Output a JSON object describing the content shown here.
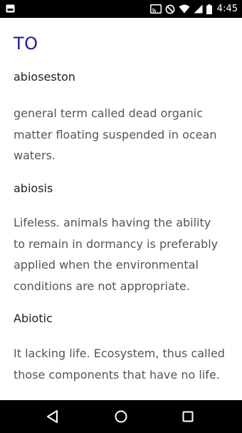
{
  "status_bar": {
    "time": "4:45",
    "left_icon": "notification-icon",
    "right_icons": [
      "cast-icon",
      "do-not-disturb-icon",
      "wifi-icon",
      "signal-icon",
      "battery-icon"
    ]
  },
  "glossary": {
    "section_letter": "TO",
    "entries": [
      {
        "term": "abioseston",
        "definition_lines": [
          "general term called dead organic",
          "matter floating suspended in ocean",
          "waters."
        ]
      },
      {
        "term": "abiosis",
        "definition_lines": [
          "Lifeless. animals having the ability",
          "to remain in dormancy is preferably",
          "applied when the environmental",
          "conditions are not appropriate."
        ]
      },
      {
        "term": "Abiotic",
        "definition_lines": [
          "It lacking life. Ecosystem, thus called",
          "those components that have no life."
        ]
      }
    ]
  },
  "nav_bar": {
    "icons": [
      "back-icon",
      "home-icon",
      "recents-icon"
    ]
  },
  "colors": {
    "section_letter": "#1a1aa6",
    "term": "#222222",
    "definition": "#555555",
    "bars": "#000000"
  }
}
